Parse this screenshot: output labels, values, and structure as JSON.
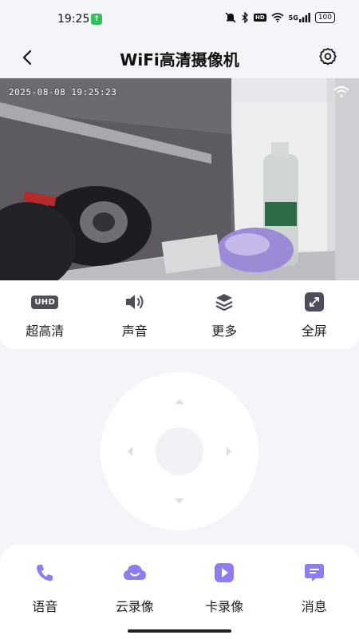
{
  "status_bar": {
    "time": "19:25",
    "network": "5G",
    "hd": "HD",
    "battery": "100"
  },
  "header": {
    "title": "WiFi高清摄像机"
  },
  "video": {
    "timestamp": "2025-08-08  19:25:23"
  },
  "controls": [
    {
      "label": "超高清",
      "icon": "uhd-icon",
      "badge": "UHD"
    },
    {
      "label": "声音",
      "icon": "speaker-icon"
    },
    {
      "label": "更多",
      "icon": "layers-icon"
    },
    {
      "label": "全屏",
      "icon": "fullscreen-icon"
    }
  ],
  "bottom_bar": [
    {
      "label": "语音",
      "icon": "phone-icon"
    },
    {
      "label": "云录像",
      "icon": "cloud-icon"
    },
    {
      "label": "卡录像",
      "icon": "play-icon"
    },
    {
      "label": "消息",
      "icon": "message-icon"
    }
  ],
  "colors": {
    "accent": "#8f7cf0",
    "background": "#f4f5f9",
    "icon_dark": "#4e4e58"
  }
}
